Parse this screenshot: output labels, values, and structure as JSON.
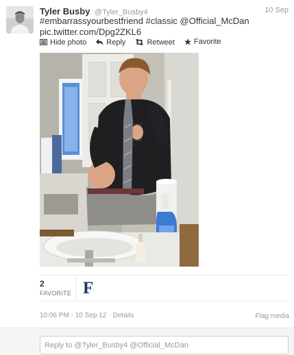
{
  "tweet": {
    "avatar_icon": "user-avatar-photo",
    "fullname": "Tyler Busby",
    "username": "@Tyler_Busby4",
    "timestamp": "10 Sep",
    "text": {
      "hashtag1": "#embarrassyourbestfriend",
      "hashtag2": "#classic",
      "mention": "@Official_McDan",
      "link": "pic.twitter.com/Dpg2ZKL6"
    },
    "link_color": "#333333"
  },
  "actions": {
    "hide_photo": {
      "label": "Hide photo",
      "icon": "photo-icon"
    },
    "reply": {
      "label": "Reply",
      "icon": "reply-arrow-icon"
    },
    "retweet": {
      "label": "Retweet",
      "icon": "retweet-icon"
    },
    "favorite": {
      "label": "Favorite",
      "icon": "star-icon"
    }
  },
  "media": {
    "description_icon": "bathroom-mirror-selfie-photo"
  },
  "stats": {
    "favorites_count": "2",
    "favorites_label": "FAVORITE",
    "favoriter_avatar_letter": "F",
    "favoriter_avatar_color": "#1c3563"
  },
  "footer": {
    "time": "10:06 PM - 10 Sep 12",
    "separator": "·",
    "details": "Details",
    "flag_media": "Flag media"
  },
  "reply": {
    "placeholder": "Reply to @Tyler_Busby4 @Official_McDan"
  }
}
